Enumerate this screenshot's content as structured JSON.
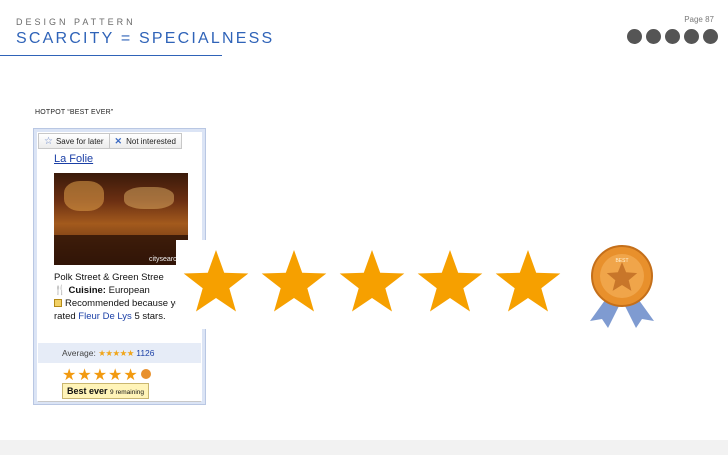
{
  "header": {
    "kicker": "DESIGN PATTERN",
    "title": "SCARCITY = SPECIALNESS",
    "page": "Page 87",
    "dots": 5
  },
  "section_label": "HOTPOT “BEST EVER”",
  "card": {
    "save_label": "Save for later",
    "not_interested_label": "Not interested",
    "name": "La Folie",
    "photo_credit": "citysearch.c",
    "address": "Polk Street & Green Stree",
    "cuisine_label": "Cuisine:",
    "cuisine_value": "European",
    "recommended_text": "Recommended because you rated",
    "recommended_link": "Fleur De Lys",
    "recommended_tail": "5 stars.",
    "average_label": "Average:",
    "average_stars": "★★★★★",
    "average_count": "1126",
    "user_rating": 5,
    "rating_stars": "★★★★★",
    "tooltip_main": "Best ever",
    "tooltip_sub": "9 remaining"
  },
  "zoom": {
    "stars": 5,
    "star_color": "#f6a000",
    "medal_color": "#e8902c",
    "ribbon_color": "#7f9bd1",
    "medal_text": "BEST"
  },
  "colors": {
    "title": "#2f63b8",
    "dots": "#555555",
    "link": "#1a3fa6"
  }
}
